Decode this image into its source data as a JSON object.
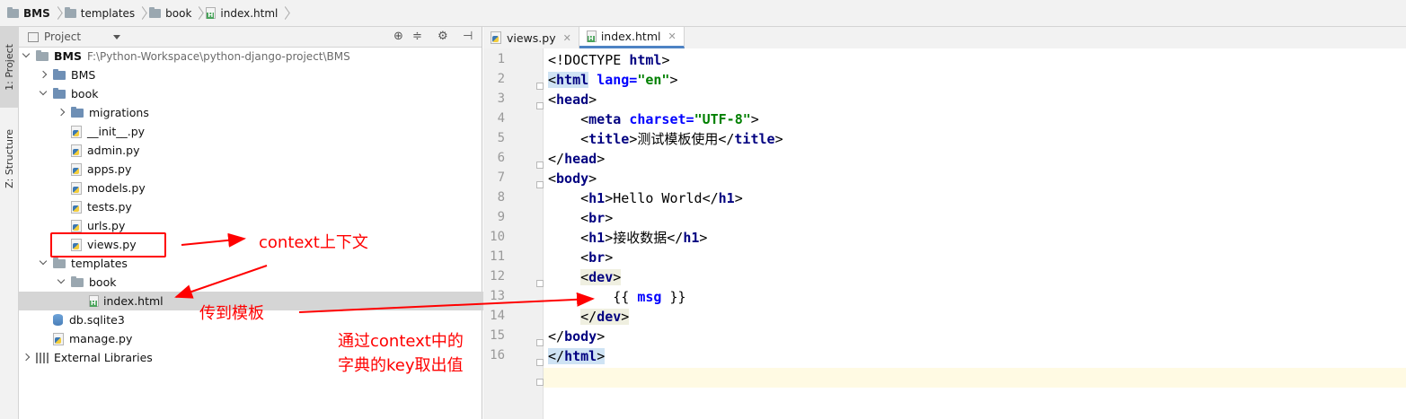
{
  "breadcrumb": [
    "BMS",
    "templates",
    "book",
    "index.html"
  ],
  "tool_strip": {
    "project_tab": "1: Project",
    "structure_tab": "Z: Structure"
  },
  "project_panel": {
    "title": "Project",
    "tree": [
      {
        "label": "BMS",
        "path": "F:\\Python-Workspace\\python-django-project\\BMS"
      },
      {
        "label": "BMS"
      },
      {
        "label": "book"
      },
      {
        "label": "migrations"
      },
      {
        "label": "__init__.py"
      },
      {
        "label": "admin.py"
      },
      {
        "label": "apps.py"
      },
      {
        "label": "models.py"
      },
      {
        "label": "tests.py"
      },
      {
        "label": "urls.py"
      },
      {
        "label": "views.py"
      },
      {
        "label": "templates"
      },
      {
        "label": "book"
      },
      {
        "label": "index.html"
      },
      {
        "label": "db.sqlite3"
      },
      {
        "label": "manage.py"
      },
      {
        "label": "External Libraries"
      }
    ]
  },
  "editor": {
    "tabs": [
      {
        "label": "views.py",
        "active": false
      },
      {
        "label": "index.html",
        "active": true
      }
    ],
    "line_numbers": [
      "1",
      "2",
      "3",
      "4",
      "5",
      "6",
      "7",
      "8",
      "9",
      "10",
      "11",
      "12",
      "13",
      "14",
      "15",
      "16"
    ]
  },
  "annotations": {
    "context": "context上下文",
    "pass_to_template": "传到模板",
    "note_line1": "通过context中的",
    "note_line2": "字典的key取出值",
    "color": "#ff0000"
  }
}
